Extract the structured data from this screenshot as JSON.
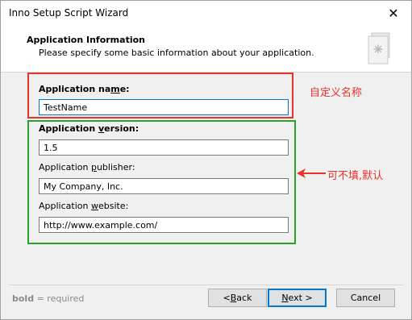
{
  "window": {
    "title": "Inno Setup Script Wizard",
    "close_glyph": "✕"
  },
  "header": {
    "title": "Application Information",
    "subtitle": "Please specify some basic information about your application.",
    "icon": "document-gear-icon"
  },
  "form": {
    "name_label": {
      "pre": "Application na",
      "u": "m",
      "post": "e:"
    },
    "name_value": "TestName",
    "version_label": {
      "pre": "Application ",
      "u": "v",
      "post": "ersion:"
    },
    "version_value": "1.5",
    "publisher_label": {
      "pre": "Application ",
      "u": "p",
      "post": "ublisher:"
    },
    "publisher_value": "My Company, Inc.",
    "website_label": {
      "pre": "Application ",
      "u": "w",
      "post": "ebsite:"
    },
    "website_value": "http://www.example.com/"
  },
  "annotations": {
    "red_note": "自定义名称",
    "green_note": "可不填,默认",
    "red_color": "#e8322a",
    "green_color": "#2aa22a"
  },
  "footer": {
    "hint_bold": "bold",
    "hint_rest": " = required",
    "back": {
      "pre": "< ",
      "u": "B",
      "post": "ack"
    },
    "next": {
      "pre": "",
      "u": "N",
      "post": "ext >"
    },
    "cancel": "Cancel"
  }
}
